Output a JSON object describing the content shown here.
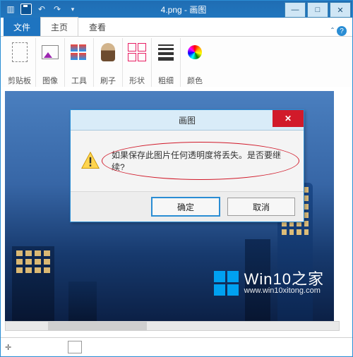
{
  "titlebar": {
    "title": "4.png - 画图"
  },
  "ribbon": {
    "file_tab": "文件",
    "tabs": [
      {
        "label": "主页"
      },
      {
        "label": "查看"
      }
    ],
    "groups": [
      {
        "label": "剪贴板"
      },
      {
        "label": "图像"
      },
      {
        "label": "工具"
      },
      {
        "label": "刷子"
      },
      {
        "label": "形状"
      },
      {
        "label": "粗细"
      },
      {
        "label": "颜色"
      }
    ]
  },
  "dialog": {
    "title": "画图",
    "message": "如果保存此图片任何透明度将丢失。是否要继续?",
    "ok": "确定",
    "cancel": "取消"
  },
  "watermark": {
    "brand": "Win10之家",
    "url": "www.win10xitong.com"
  }
}
